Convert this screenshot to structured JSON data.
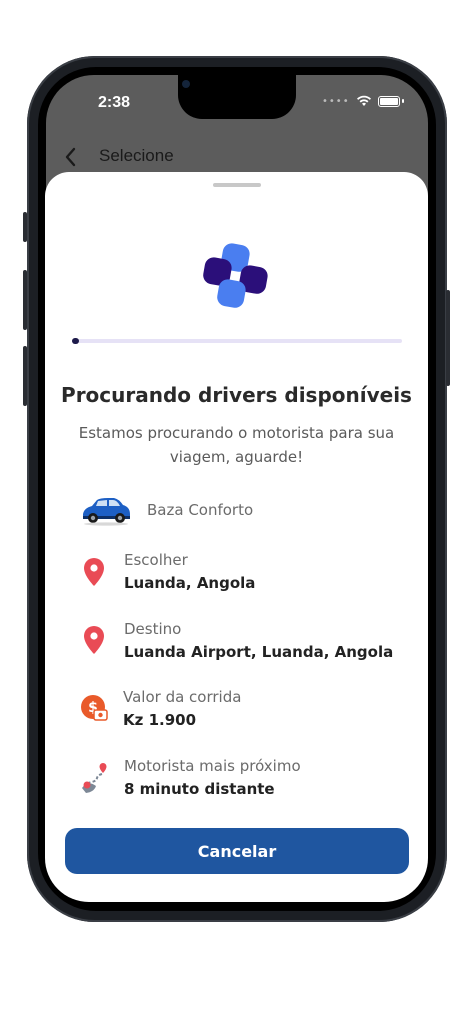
{
  "status_bar": {
    "time": "2:38"
  },
  "header": {
    "title": "Selecione"
  },
  "searching": {
    "title": "Procurando drivers disponíveis",
    "subtitle": "Estamos procurando o motorista para sua viagem, aguarde!",
    "progress": 0.02
  },
  "details": {
    "car": {
      "name": "Baza Conforto",
      "icon": "car-icon"
    },
    "pickup": {
      "label": "Escolher",
      "value": "Luanda, Angola",
      "icon": "location-pin-icon"
    },
    "destination": {
      "label": "Destino",
      "value": "Luanda Airport, Luanda, Angola",
      "icon": "location-pin-icon"
    },
    "fare": {
      "label": "Valor da corrida",
      "value": "Kz 1.900",
      "icon": "money-icon"
    },
    "driver": {
      "label": "Motorista mais próximo",
      "value": "8 minuto distante",
      "icon": "route-icon"
    }
  },
  "actions": {
    "cancel_label": "Cancelar"
  },
  "colors": {
    "primary": "#1f56a0",
    "pin": "#e94b55",
    "money": "#e95a2a",
    "logo_dark": "#2b0f7a",
    "logo_light": "#4a7ef0"
  }
}
